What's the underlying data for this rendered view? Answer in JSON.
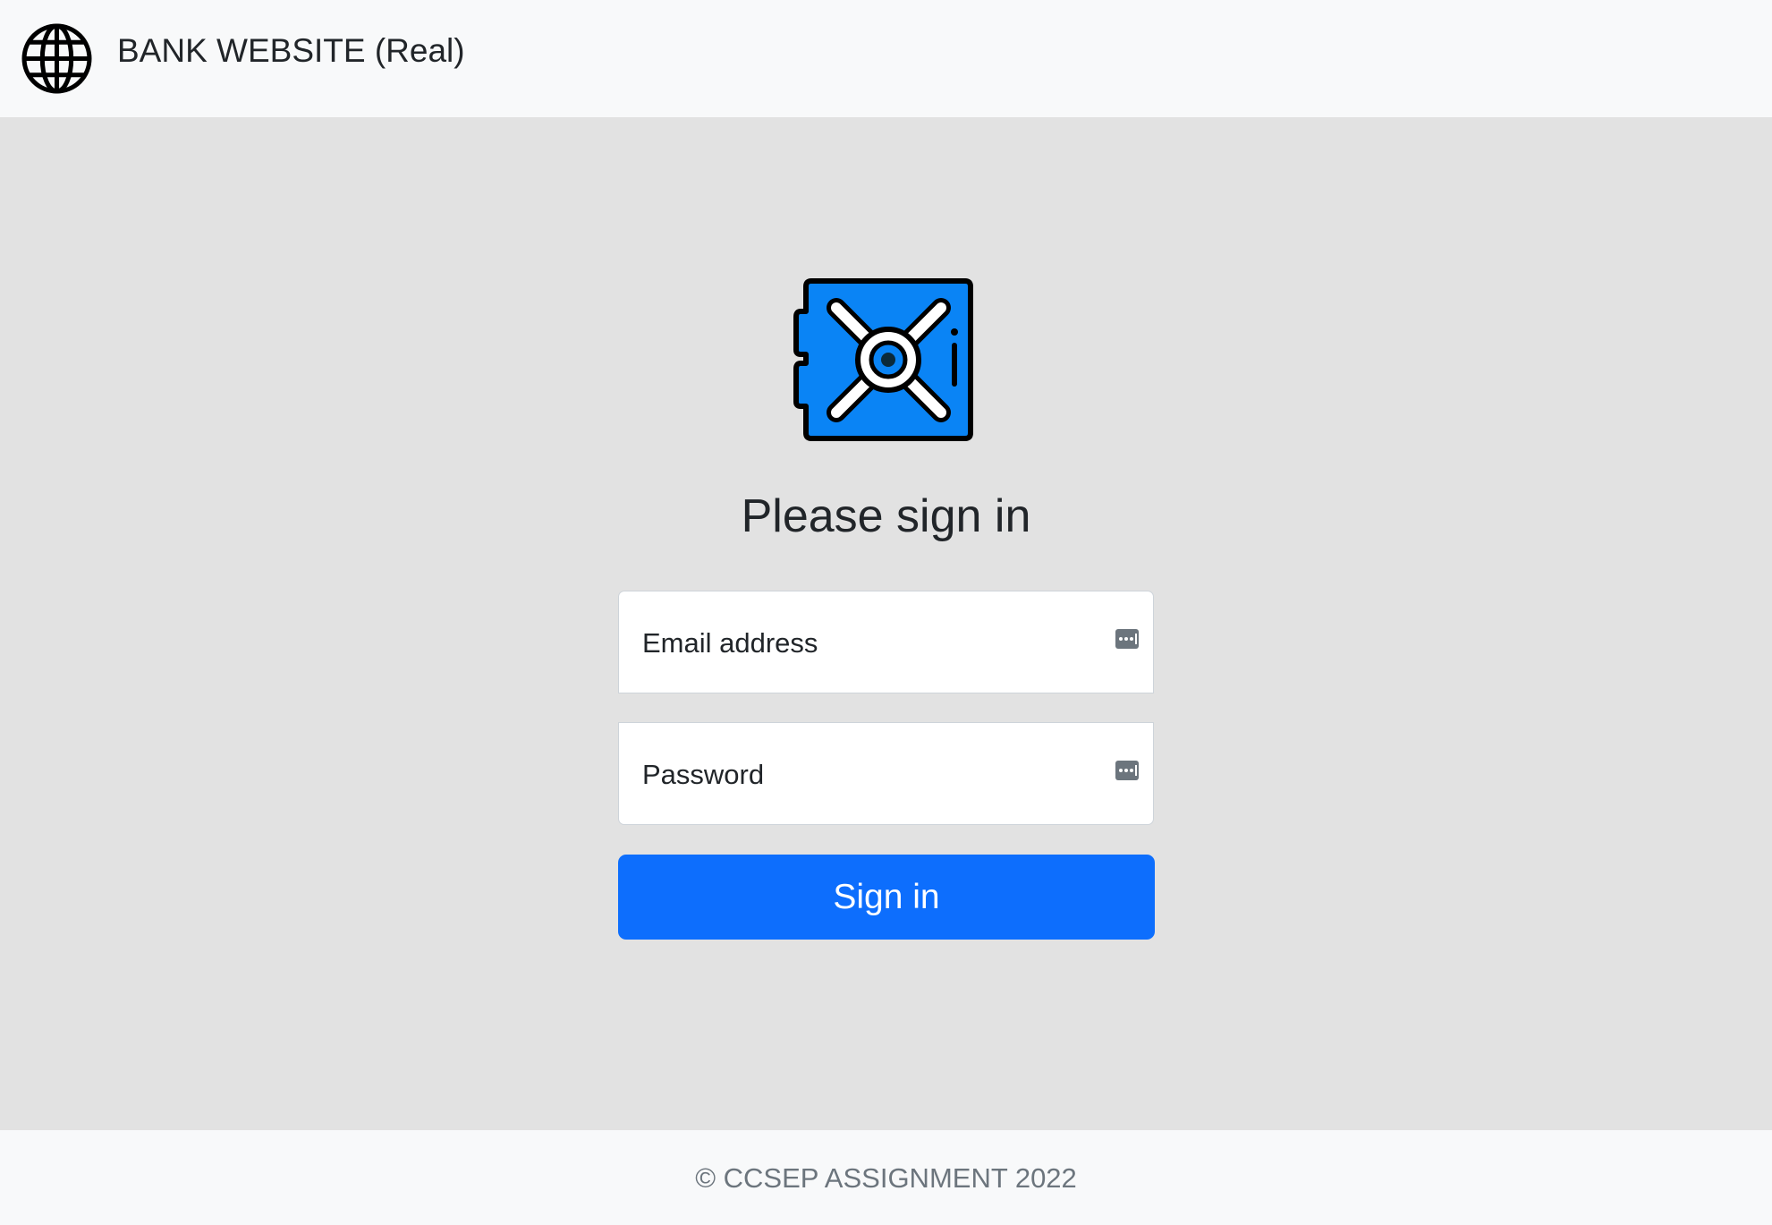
{
  "header": {
    "brand_icon": "globe-icon",
    "brand_text": "BANK WEBSITE (Real)"
  },
  "main": {
    "logo_icon": "safe-vault-icon",
    "title": "Please sign in",
    "email": {
      "label": "Email address",
      "value": "",
      "icon": "password-manager-icon"
    },
    "password": {
      "label": "Password",
      "value": "",
      "icon": "password-manager-icon"
    },
    "submit_label": "Sign in"
  },
  "footer": {
    "copyright": "© CCSEP ASSIGNMENT 2022"
  },
  "colors": {
    "primary": "#0d6efd",
    "navbar_bg": "#f8f9fa",
    "page_bg": "#e2e2e2",
    "text": "#212529",
    "muted_text": "#6c757d",
    "vault_blue": "#0a84f5"
  }
}
